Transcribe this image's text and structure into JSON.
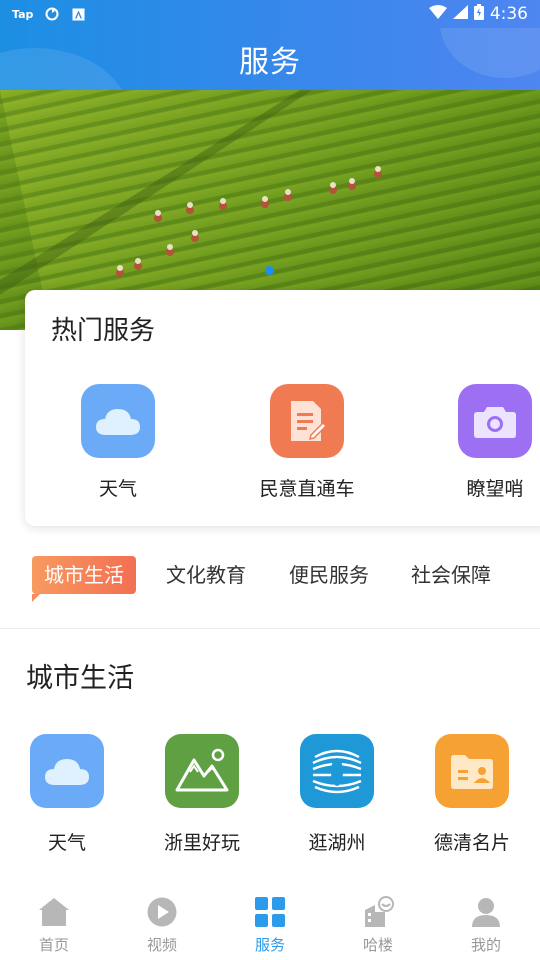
{
  "status_bar": {
    "left_text": "Tap",
    "time": "4:36"
  },
  "header": {
    "title": "服务"
  },
  "hot_services": {
    "title": "热门服务",
    "items": [
      {
        "label": "天气",
        "icon": "cloud-icon",
        "color": "#4f9bf6"
      },
      {
        "label": "民意直通车",
        "icon": "document-edit-icon",
        "color": "#f06a45"
      },
      {
        "label": "瞭望哨",
        "icon": "camera-icon",
        "color": "#9b6cf2"
      }
    ]
  },
  "tabs": [
    {
      "label": "城市生活",
      "active": true
    },
    {
      "label": "文化教育",
      "active": false
    },
    {
      "label": "便民服务",
      "active": false
    },
    {
      "label": "社会保障",
      "active": false
    }
  ],
  "section": {
    "title": "城市生活",
    "items": [
      {
        "label": "天气",
        "icon": "cloud-icon",
        "color": "#4f9bf6"
      },
      {
        "label": "浙里好玩",
        "icon": "mountain-icon",
        "color": "#5fa043"
      },
      {
        "label": "逛湖州",
        "icon": "lake-bridge-icon",
        "color": "#1f98d8"
      },
      {
        "label": "德清名片",
        "icon": "id-card-icon",
        "color": "#f59b2d"
      }
    ]
  },
  "bottom_nav": [
    {
      "label": "首页",
      "icon": "home-icon",
      "active": false
    },
    {
      "label": "视频",
      "icon": "play-icon",
      "active": false
    },
    {
      "label": "服务",
      "icon": "grid-icon",
      "active": true
    },
    {
      "label": "哈楼",
      "icon": "building-icon",
      "active": false
    },
    {
      "label": "我的",
      "icon": "user-icon",
      "active": false
    }
  ],
  "colors": {
    "accent": "#2c9bec",
    "tab_active_start": "#f79a60",
    "tab_active_end": "#f36f52",
    "header_start": "#1c8fe3",
    "header_end": "#4f86f0"
  }
}
